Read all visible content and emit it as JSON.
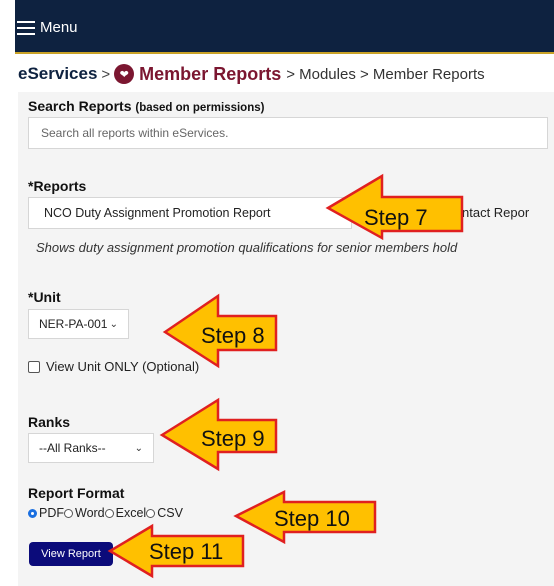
{
  "topbar": {
    "menu_label": "Menu"
  },
  "breadcrumb": {
    "root": "eServices",
    "current": "Member Reports",
    "trail": "> Modules > Member Reports"
  },
  "search": {
    "label": "Search Reports",
    "label_note": "(based on permissions)",
    "placeholder": "Search all reports within eServices."
  },
  "reports": {
    "label": "*Reports",
    "selected": "NCO Duty Assignment Promotion Report",
    "partial_next": "ntact Repor",
    "description": "Shows duty assignment promotion qualifications for senior members hold"
  },
  "unit": {
    "label": "*Unit",
    "selected": "NER-PA-001",
    "view_only_label": "View Unit ONLY (Optional)"
  },
  "ranks": {
    "label": "Ranks",
    "selected": "--All Ranks--"
  },
  "format": {
    "label": "Report Format",
    "options": [
      "PDF",
      "Word",
      "Excel",
      "CSV"
    ],
    "selected": "PDF"
  },
  "view_button": "View Report",
  "callouts": [
    "Step 7",
    "Step 8",
    "Step 9",
    "Step 10",
    "Step 11"
  ],
  "colors": {
    "nav": "#0e2240",
    "accent": "#c9a227",
    "brand": "#7b1630",
    "callout_fill": "#ffc000",
    "callout_stroke": "#e02020",
    "button": "#0b0b7a"
  }
}
